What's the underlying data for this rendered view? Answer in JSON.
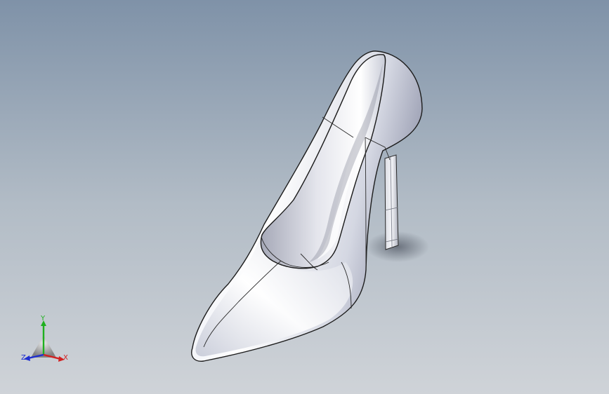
{
  "viewport": {
    "model_name": "high-heel-shoe-model"
  },
  "triad": {
    "x_label": "X",
    "y_label": "Y",
    "z_label": "Z",
    "colors": {
      "x": "#d22020",
      "y": "#1fb01f",
      "z": "#1f2fd0"
    }
  }
}
